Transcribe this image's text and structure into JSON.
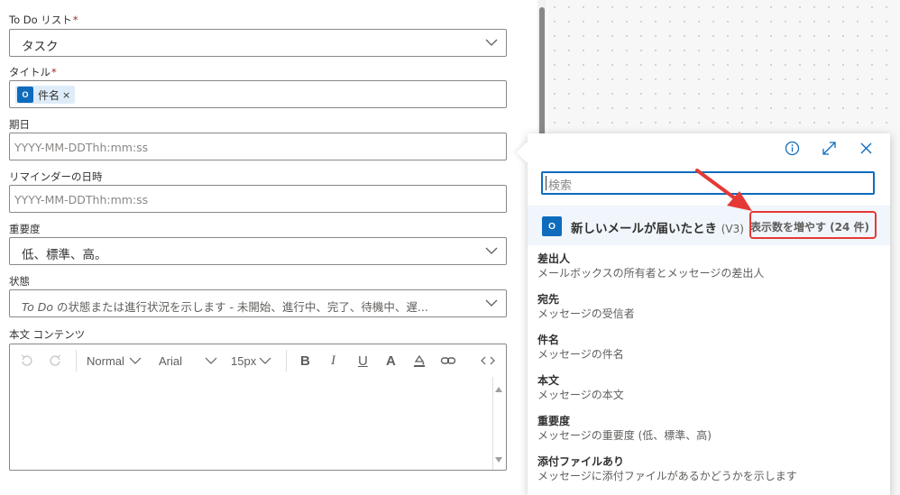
{
  "form": {
    "todo_list": {
      "label": "To Do リスト",
      "required": "*",
      "value": "タスク"
    },
    "title": {
      "label": "タイトル",
      "required": "*",
      "token_label": "件名",
      "token_remove": "×",
      "token_icon": "outlook-icon"
    },
    "due_date": {
      "label": "期日",
      "placeholder": "YYYY-MM-DDThh:mm:ss"
    },
    "reminder": {
      "label": "リマインダーの日時",
      "placeholder": "YYYY-MM-DDThh:mm:ss"
    },
    "importance": {
      "label": "重要度",
      "value": "低、標準、高。"
    },
    "status": {
      "label": "状態",
      "placeholder_em": "To Do",
      "placeholder_rest": " の状態または進行状況を示します - 未開始、進行中、完了、待機中、遅..."
    },
    "body": {
      "label": "本文 コンテンツ",
      "font_style": "Normal",
      "font_family": "Arial",
      "font_size": "15px"
    }
  },
  "popup": {
    "search_placeholder": "検索",
    "trigger_title": "新しいメールが届いたとき",
    "trigger_version": "(V3)",
    "show_more": "表示数を増やす (24 件)",
    "items": [
      {
        "title": "差出人",
        "desc": "メールボックスの所有者とメッセージの差出人"
      },
      {
        "title": "宛先",
        "desc": "メッセージの受信者"
      },
      {
        "title": "件名",
        "desc": "メッセージの件名"
      },
      {
        "title": "本文",
        "desc": "メッセージの本文"
      },
      {
        "title": "重要度",
        "desc": "メッセージの重要度 (低、標準、高)"
      },
      {
        "title": "添付ファイルあり",
        "desc": "メッセージに添付ファイルがあるかどうかを示します"
      }
    ]
  },
  "colors": {
    "accent": "#0f6cbd",
    "highlight": "#e53935",
    "arrow": "#e53935"
  }
}
